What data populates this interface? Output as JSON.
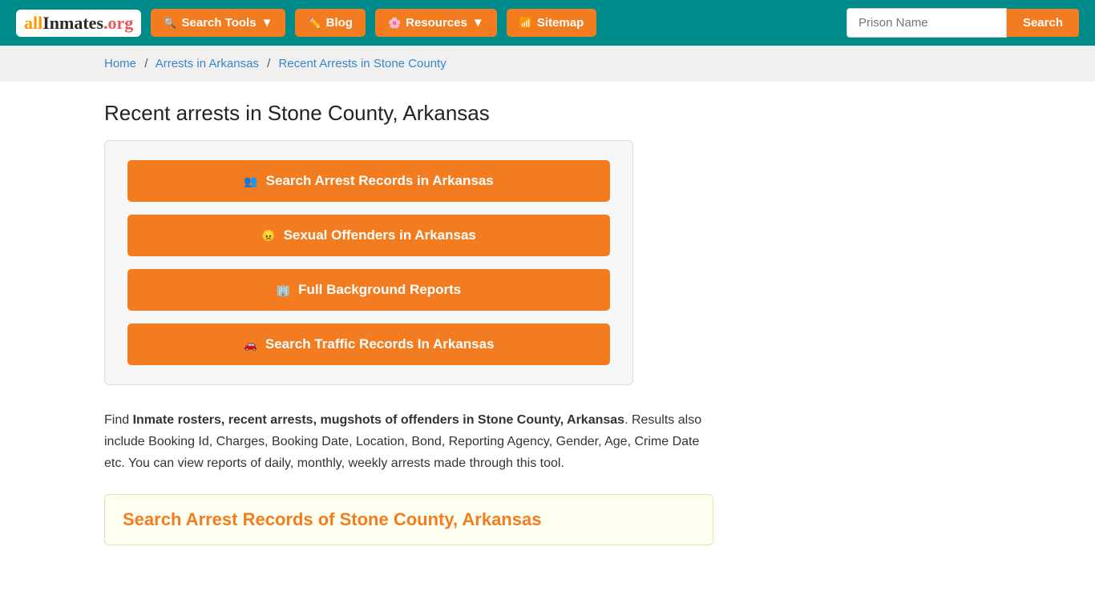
{
  "site": {
    "logo_all": "all",
    "logo_inmates": "Inmates",
    "logo_org": ".org"
  },
  "header": {
    "search_tools_label": "Search Tools",
    "blog_label": "Blog",
    "resources_label": "Resources",
    "sitemap_label": "Sitemap",
    "search_placeholder": "Prison Name",
    "search_button_label": "Search"
  },
  "breadcrumb": {
    "home": "Home",
    "arrests_arkansas": "Arrests in Arkansas",
    "current": "Recent Arrests in Stone County"
  },
  "main": {
    "page_title": "Recent arrests in Stone County, Arkansas",
    "btn_arrest_records": "Search Arrest Records in Arkansas",
    "btn_sexual_offenders": "Sexual Offenders in Arkansas",
    "btn_background": "Full Background Reports",
    "btn_traffic": "Search Traffic Records In Arkansas",
    "description_intro": "Find ",
    "description_bold": "Inmate rosters, recent arrests, mugshots of offenders in Stone County, Arkansas",
    "description_rest": ". Results also include Booking Id, Charges, Booking Date, Location, Bond, Reporting Agency, Gender, Age, Crime Date etc. You can view reports of daily, monthly, weekly arrests made through this tool.",
    "search_records_title": "Search Arrest Records of Stone County, Arkansas"
  }
}
